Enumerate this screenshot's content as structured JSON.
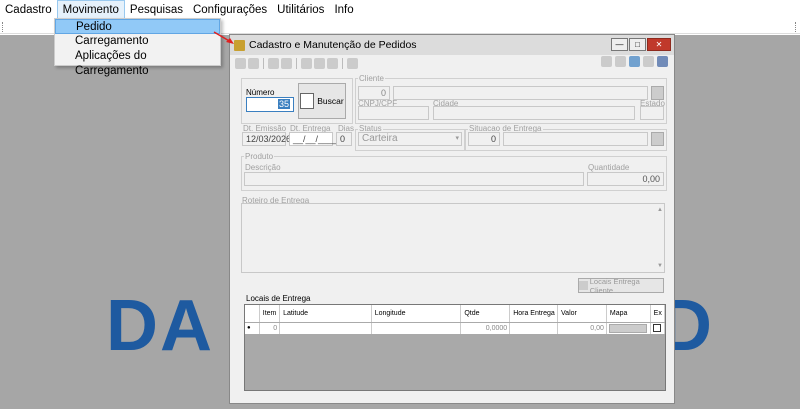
{
  "menubar": {
    "items": [
      "Cadastro",
      "Movimento",
      "Pesquisas",
      "Configurações",
      "Utilitários",
      "Info"
    ]
  },
  "dropdown": {
    "items": [
      "Pedido",
      "Carregamento",
      "Aplicações do Carregamento"
    ]
  },
  "logo": {
    "left_text": "DA",
    "right_text": "D"
  },
  "window": {
    "title": "Cadastro e Manutenção de Pedidos",
    "numero_label": "Número",
    "numero_value": "35",
    "buscar_label": "Buscar",
    "cliente_label": "Cliente",
    "cliente_code": "0",
    "cnpj_label": "CNPJ/CPF",
    "cidade_label": "Cidade",
    "estado_label": "Estado",
    "dt_emissao_label": "Dt. Emissão",
    "dt_emissao_value": "12/03/2026",
    "dt_entrega_label": "Dt. Entrega",
    "dt_entrega_value": "__/__/____",
    "dias_label": "Dias",
    "dias_value": "0",
    "status_label": "Status",
    "status_value": "Carteira",
    "situacao_label": "Situacao de Entrega",
    "situacao_code": "0",
    "produto_label": "Produto",
    "descricao_label": "Descrição",
    "quantidade_label": "Quantidade",
    "quantidade_value": "0,00",
    "roteiro_label": "Roteiro de Entrega",
    "locais_button": "Locais Entrega Cliente",
    "locais_label": "Locais de Entrega",
    "columns": [
      "Item",
      "Latitude",
      "Longitude",
      "Qtde",
      "Hora Entrega",
      "Valor",
      "Mapa",
      "Ex"
    ],
    "row": {
      "item": "0",
      "qtde": "0,0000",
      "valor": "0,00"
    }
  }
}
